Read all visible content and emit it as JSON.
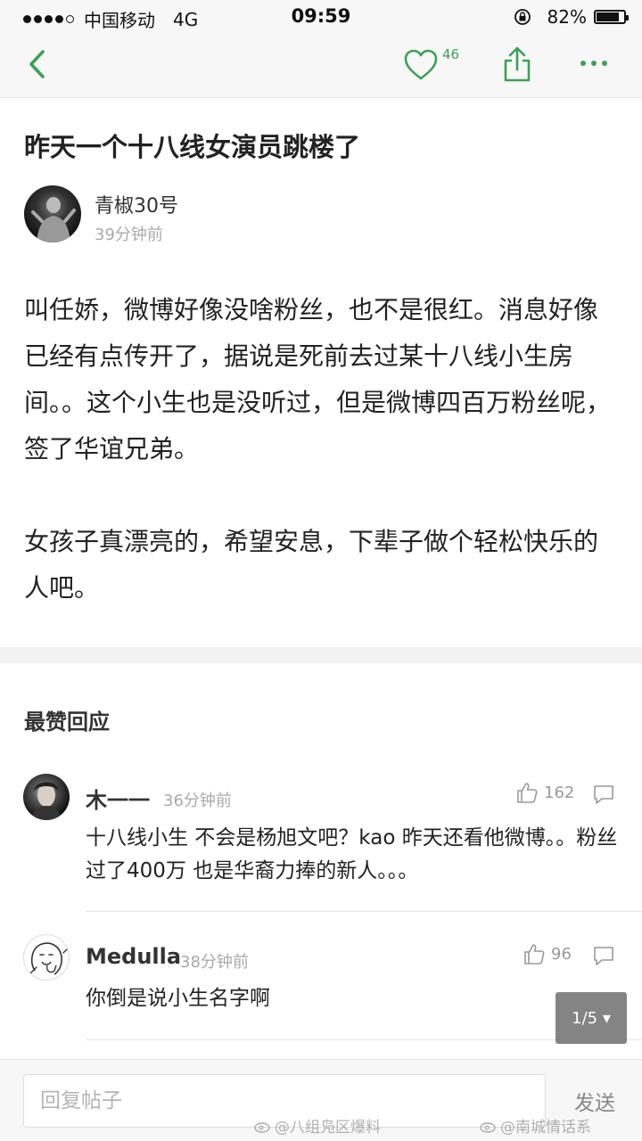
{
  "status_bar": {
    "carrier": "中国移动",
    "network": "4G",
    "time": "09:59",
    "battery": "82%",
    "battery_level": 0.82
  },
  "nav": {
    "like_count": "46",
    "accent_color": "#3ba155"
  },
  "post": {
    "title": "昨天一个十八线女演员跳楼了",
    "author": "青椒30号",
    "time": "39分钟前",
    "paragraphs": [
      "叫任娇，微博好像没啥粉丝，也不是很红。消息好像已经有点传开了，据说是死前去过某十八线小生房间。。这个小生也是没听过，但是微博四百万粉丝呢，签了华谊兄弟。",
      "女孩子真漂亮的，希望安息，下辈子做个轻松快乐的人吧。"
    ]
  },
  "replies_section": {
    "heading": "最赞回应",
    "comments": [
      {
        "user": "木一一",
        "time": "36分钟前",
        "likes": "162",
        "text": "十八线小生  不会是杨旭文吧？kao 昨天还看他微博。。粉丝过了400万 也是华裔力捧的新人。。。"
      },
      {
        "user": "Medulla",
        "time": "38分钟前",
        "likes": "96",
        "text": "你倒是说小生名字啊"
      }
    ]
  },
  "page_indicator": "1/5 ▾",
  "reply_bar": {
    "placeholder": "回复帖子",
    "send_label": "发送"
  },
  "watermarks": [
    "@八组凫区爆料",
    "@南城情话系"
  ]
}
